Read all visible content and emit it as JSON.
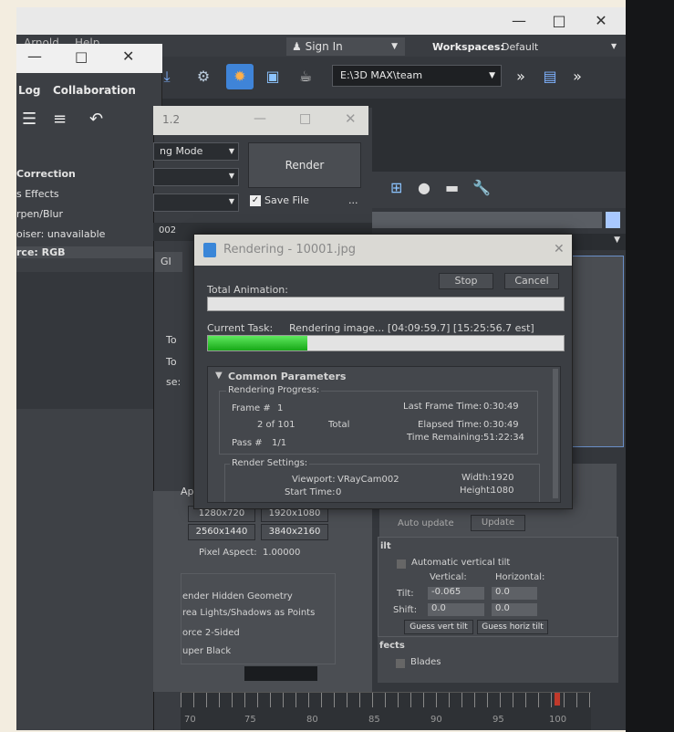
{
  "title_bar": {
    "minimize": "—",
    "maximize": "□",
    "close": "✕"
  },
  "menu": {
    "items": [
      "Arnold",
      "Help"
    ]
  },
  "signin": {
    "label": "Sign In"
  },
  "workspaces": {
    "label": "Workspaces:",
    "value": "Default"
  },
  "toolbar": {
    "path": "E:\\3D MAX\\team"
  },
  "left_window": {
    "menu": [
      "Log",
      "Collaboration"
    ],
    "items": [
      "Correction",
      "s Effects",
      "rpen/Blur",
      "oiser: unavailable",
      "rce: RGB"
    ]
  },
  "render_setup": {
    "title": "1.2",
    "mode_label": "ng Mode",
    "render_button": "Render",
    "save_file": "Save File",
    "more_button": "...",
    "field_002": "002",
    "tab_gi": "GI",
    "to_labels": [
      "To",
      "To",
      "se:"
    ],
    "ap_label": "Ap",
    "presets": [
      "1280x720",
      "1920x1080",
      "2560x1440",
      "3840x2160"
    ],
    "pixel_aspect_label": "Pixel Aspect:",
    "pixel_aspect_value": "1.00000",
    "options": [
      "ender Hidden Geometry",
      "rea Lights/Shadows as Points",
      "orce 2-Sided",
      "uper Black"
    ]
  },
  "right_panel": {
    "auto_update": "Auto update",
    "update_button": "Update",
    "tilt_section": "ilt",
    "auto_tilt": "Automatic vertical tilt",
    "vertical": "Vertical:",
    "horizontal": "Horizontal:",
    "tilt_label": "Tilt:",
    "shift_label": "Shift:",
    "tilt_v": "-0.065",
    "tilt_h": "0.0",
    "shift_v": "0.0",
    "shift_h": "0.0",
    "guess_vert": "Guess vert tilt",
    "guess_horiz": "Guess horiz tilt",
    "effects_section": "fects",
    "blades": "Blades"
  },
  "rendering_dialog": {
    "title": "Rendering - 10001.jpg",
    "close": "✕",
    "stop_button": "Stop",
    "cancel_button": "Cancel",
    "total_animation_label": "Total Animation:",
    "total_progress": 0,
    "current_task_label": "Current Task:",
    "current_task_value": "Rendering image... [04:09:59.7] [15:25:56.7 est]",
    "task_progress": 0.28,
    "common_parameters": "Common Parameters",
    "rendering_progress": "Rendering Progress:",
    "frame_label": "Frame #",
    "frame_value": "1",
    "frame_of": "2 of 101",
    "total_label": "Total",
    "pass_label": "Pass #",
    "pass_value": "1/1",
    "last_frame_time_label": "Last Frame Time:",
    "last_frame_time": "0:30:49",
    "elapsed_time_label": "Elapsed Time:",
    "elapsed_time": "0:30:49",
    "time_remaining_label": "Time Remaining:",
    "time_remaining": "51:22:34",
    "render_settings": "Render Settings:",
    "viewport_label": "Viewport:",
    "viewport_value": "VRayCam002",
    "start_time_label": "Start Time:",
    "start_time_value": "0",
    "width_label": "Width:",
    "width_value": "1920",
    "height_label": "Height:",
    "height_value": "1080"
  },
  "timeline": {
    "ticks": [
      "70",
      "75",
      "80",
      "85",
      "90",
      "95",
      "100"
    ]
  }
}
